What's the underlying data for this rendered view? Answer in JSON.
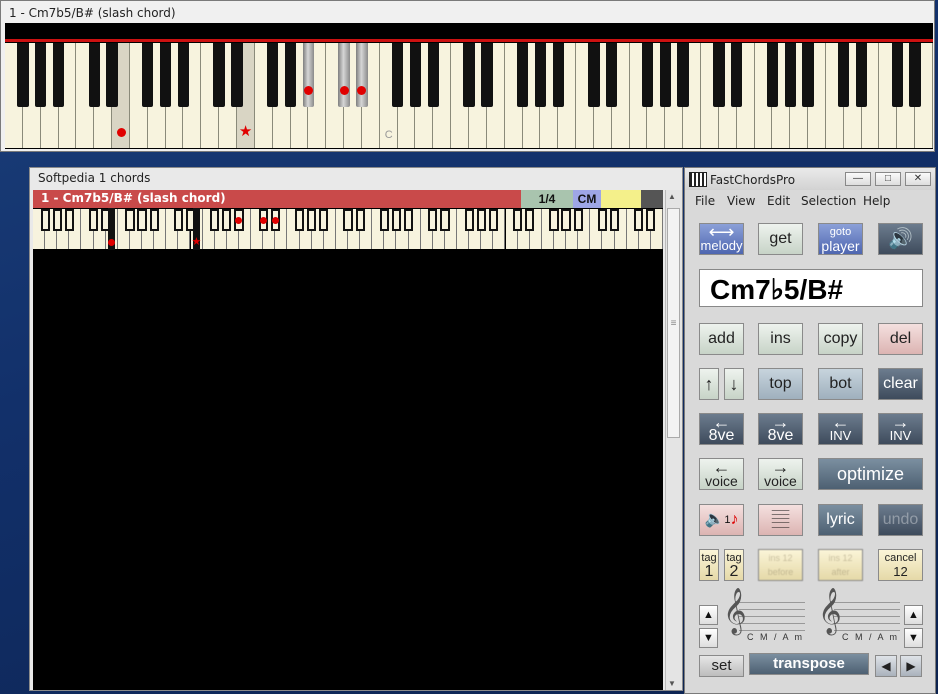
{
  "top_window": {
    "title": "1  -  Cm7b5/B# (slash chord)",
    "c_label": "C"
  },
  "song_window": {
    "title": "Softpedia    1 chords",
    "chord_label": "1  -  Cm7b5/B# (slash chord)",
    "fraction": "1/4",
    "key": "CM",
    "scroll_grip": "≡"
  },
  "app": {
    "title": "FastChordsPro",
    "window_buttons": [
      "—",
      "□",
      "✕"
    ],
    "menu": [
      "File",
      "View",
      "Edit",
      "Selection",
      "Help"
    ],
    "chord_display": "Cm7♭5/B#",
    "buttons": {
      "melody": "melody",
      "get": "get",
      "goto": "goto",
      "player": "player",
      "add": "add",
      "ins": "ins",
      "copy": "copy",
      "del": "del",
      "top": "top",
      "bot": "bot",
      "clear": "clear",
      "octave": "8ve",
      "inv": "INV",
      "voice": "voice",
      "optimize": "optimize",
      "lyric": "lyric",
      "undo": "undo",
      "tag": "tag",
      "tag1": "1",
      "tag2": "2",
      "ins_before": "ins 12 before",
      "ins_after": "ins 12 after",
      "cancel": "cancel",
      "cancel_num": "12",
      "set": "set",
      "transpose": "transpose"
    },
    "staff_labels": [
      "C M / A m",
      "C M / A m"
    ]
  },
  "colors": {
    "accent_red": "#e00000",
    "chord_bar": "#c94a4a",
    "key_highlight": "#9ea6e6"
  }
}
